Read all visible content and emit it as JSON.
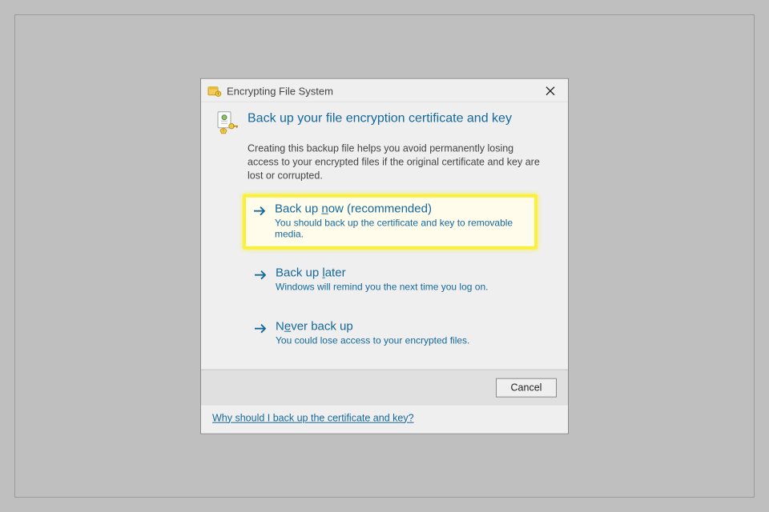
{
  "titlebar": {
    "title": "Encrypting File System"
  },
  "header": {
    "heading": "Back up your file encryption certificate and key",
    "description": "Creating this backup file helps you avoid permanently losing access to your encrypted files if the original certificate and key are lost or corrupted."
  },
  "options": [
    {
      "title_pre": "Back up ",
      "title_ul": "n",
      "title_post": "ow (recommended)",
      "subtitle": "You should back up the certificate and key to removable media.",
      "highlighted": true
    },
    {
      "title_pre": "Back up ",
      "title_ul": "l",
      "title_post": "ater",
      "subtitle": "Windows will remind you the next time you log on.",
      "highlighted": false
    },
    {
      "title_pre": "N",
      "title_ul": "e",
      "title_post": "ver back up",
      "subtitle": "You could lose access to your encrypted files.",
      "highlighted": false
    }
  ],
  "footer": {
    "cancel": "Cancel"
  },
  "help_link": "Why should I back up the certificate and key?"
}
